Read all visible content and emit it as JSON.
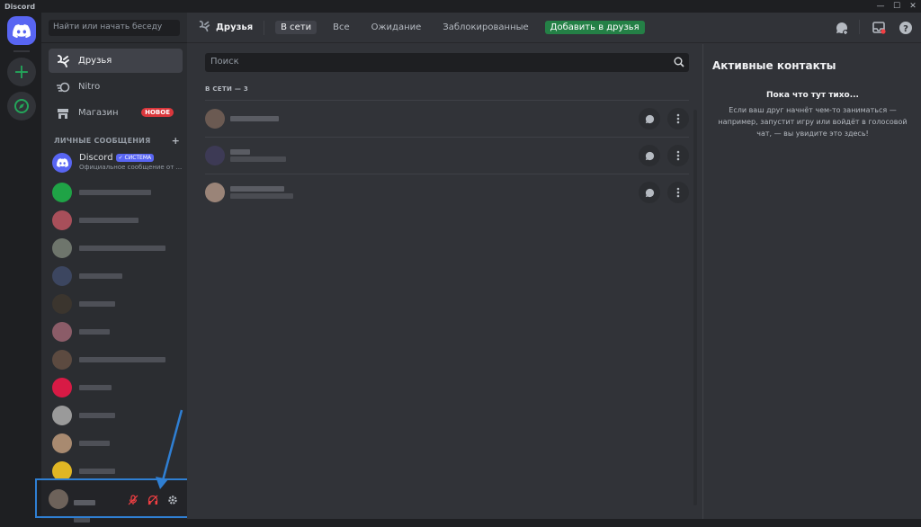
{
  "window": {
    "title": "Discord",
    "controls": [
      "—",
      "☐",
      "✕"
    ]
  },
  "sidebar": {
    "search_placeholder": "Найти или начать беседу",
    "nav": [
      {
        "label": "Друзья",
        "icon": "friends-icon",
        "active": true
      },
      {
        "label": "Nitro",
        "icon": "nitro-icon"
      },
      {
        "label": "Магазин",
        "icon": "shop-icon",
        "badge": "НОВОЕ"
      }
    ],
    "dm_header": "ЛИЧНЫЕ СООБЩЕНИЯ",
    "dm_add": "+",
    "dms": [
      {
        "name": "Discord",
        "tag": "✓ СИСТЕМА",
        "subtitle": "Официальное сообщение от ...",
        "avatar_color": "#5865f2"
      },
      {
        "avatar_color": "#1fa346"
      },
      {
        "avatar_color": "#a84f5a"
      },
      {
        "avatar_color": "#6e756c"
      },
      {
        "avatar_color": "#3c4660"
      },
      {
        "avatar_color": "#3b352e"
      },
      {
        "avatar_color": "#8b5c68"
      },
      {
        "avatar_color": "#5c4a40"
      },
      {
        "avatar_color": "#d81a45"
      },
      {
        "avatar_color": "#9a9a9a"
      },
      {
        "avatar_color": "#a88a70"
      },
      {
        "avatar_color": "#e0b624"
      },
      {
        "avatar_color": "#c7a21f"
      }
    ]
  },
  "user_panel": {
    "avatar_color": "#6d625a",
    "mute_icon": "mic-muted-icon",
    "deafen_icon": "headphones-muted-icon",
    "settings_icon": "gear-icon",
    "status_color": "#f23f43"
  },
  "header": {
    "title": "Друзья",
    "tabs": [
      {
        "label": "В сети",
        "active": true
      },
      {
        "label": "Все"
      },
      {
        "label": "Ожидание"
      },
      {
        "label": "Заблокированные"
      }
    ],
    "add_friend": "Добавить в друзья",
    "add_friend_color": "#248046"
  },
  "friends": {
    "search_placeholder": "Поиск",
    "section_label": "В СЕТИ — 3",
    "rows": [
      {
        "avatar_color": "#6b5a52"
      },
      {
        "avatar_color": "#3d3a55"
      },
      {
        "avatar_color": "#9a8478"
      }
    ]
  },
  "active_now": {
    "title": "Активные контакты",
    "empty_title": "Пока что тут тихо...",
    "empty_desc": "Если ваш друг начнёт чем-то заниматься — например, запустит игру или войдёт в голосовой чат, — вы увидите это здесь!"
  }
}
